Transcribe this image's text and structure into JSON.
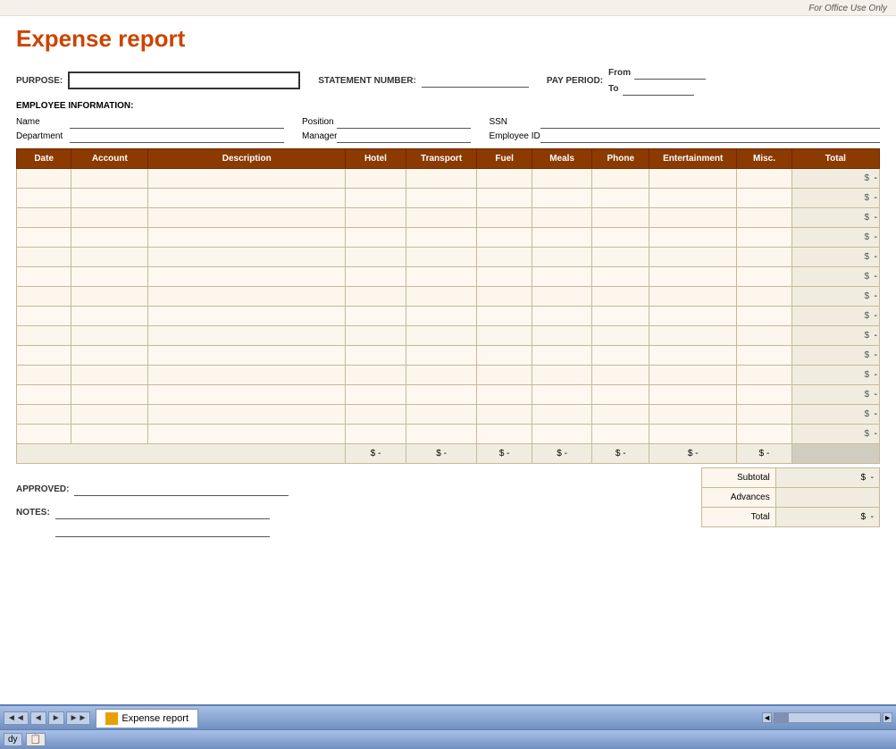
{
  "office_use_banner": "For Office Use Only",
  "title": "Expense report",
  "form": {
    "purpose_label": "PURPOSE:",
    "purpose_value": "",
    "statement_number_label": "STATEMENT NUMBER:",
    "statement_number_value": "",
    "pay_period_label": "PAY PERIOD:",
    "pay_period_from_label": "From",
    "pay_period_to_label": "To",
    "pay_period_from_value": "",
    "pay_period_to_value": ""
  },
  "employee": {
    "section_label": "EMPLOYEE INFORMATION:",
    "name_label": "Name",
    "name_value": "",
    "position_label": "Position",
    "position_value": "",
    "ssn_label": "SSN",
    "ssn_value": "",
    "department_label": "Department",
    "department_value": "",
    "manager_label": "Manager",
    "manager_value": "",
    "employee_id_label": "Employee ID",
    "employee_id_value": ""
  },
  "table": {
    "headers": [
      "Date",
      "Account",
      "Description",
      "Hotel",
      "Transport",
      "Fuel",
      "Meals",
      "Phone",
      "Entertainment",
      "Misc.",
      "Total"
    ],
    "row_count": 14,
    "dollar_sign": "$",
    "dash": "-"
  },
  "totals_row": {
    "cells": [
      "$",
      "-",
      "$",
      "-",
      "$",
      "-",
      "$",
      "-",
      "$",
      "-",
      "$",
      "-",
      "$",
      "-"
    ]
  },
  "summary": {
    "subtotal_label": "Subtotal",
    "advances_label": "Advances",
    "total_label": "Total",
    "dollar_sign": "$",
    "dash": "-"
  },
  "bottom": {
    "approved_label": "APPROVED:",
    "approved_value": "",
    "notes_label": "NOTES:",
    "notes_line1": "",
    "notes_line2": ""
  },
  "taskbar": {
    "nav_prev_prev": "◄◄",
    "nav_prev": "◄",
    "nav_next": "►",
    "nav_next_next": "►►",
    "tab_label": "Expense report"
  }
}
